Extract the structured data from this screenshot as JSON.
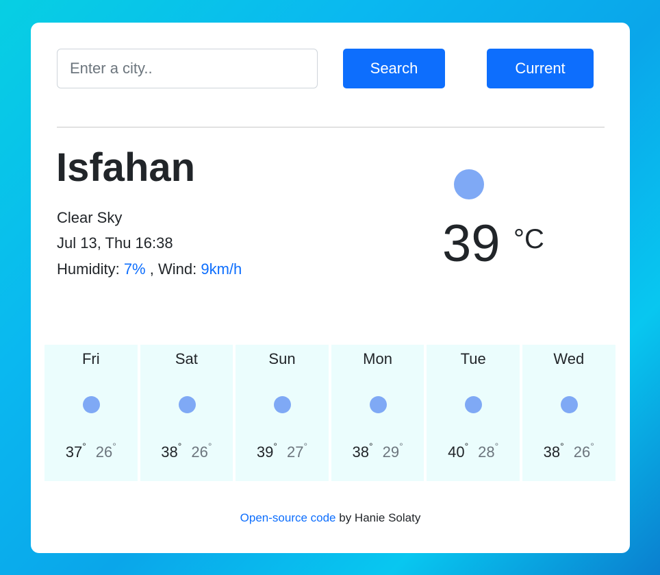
{
  "search": {
    "placeholder": "Enter a city..",
    "value": "",
    "search_label": "Search",
    "current_label": "Current"
  },
  "current": {
    "city": "Isfahan",
    "description": "Clear Sky",
    "datetime": "Jul 13, Thu 16:38",
    "humidity_label": "Humidity:",
    "humidity_value": "7%",
    "wind_label": ", Wind:",
    "wind_value": "9km/h",
    "temperature": "39",
    "unit": "°C",
    "icon": "sun-icon"
  },
  "forecast": [
    {
      "day": "Fri",
      "max": "37",
      "min": "26",
      "deg": "°"
    },
    {
      "day": "Sat",
      "max": "38",
      "min": "26",
      "deg": "°"
    },
    {
      "day": "Sun",
      "max": "39",
      "min": "27",
      "deg": "°"
    },
    {
      "day": "Mon",
      "max": "38",
      "min": "29",
      "deg": "°"
    },
    {
      "day": "Tue",
      "max": "40",
      "min": "28",
      "deg": "°"
    },
    {
      "day": "Wed",
      "max": "38",
      "min": "26",
      "deg": "°"
    }
  ],
  "footer": {
    "link_text": "Open-source code",
    "by_text": " by Hanie Solaty"
  },
  "colors": {
    "accent": "#0d6efd",
    "icon": "#7fa9f5",
    "forecast_bg": "#ebfdfd"
  }
}
